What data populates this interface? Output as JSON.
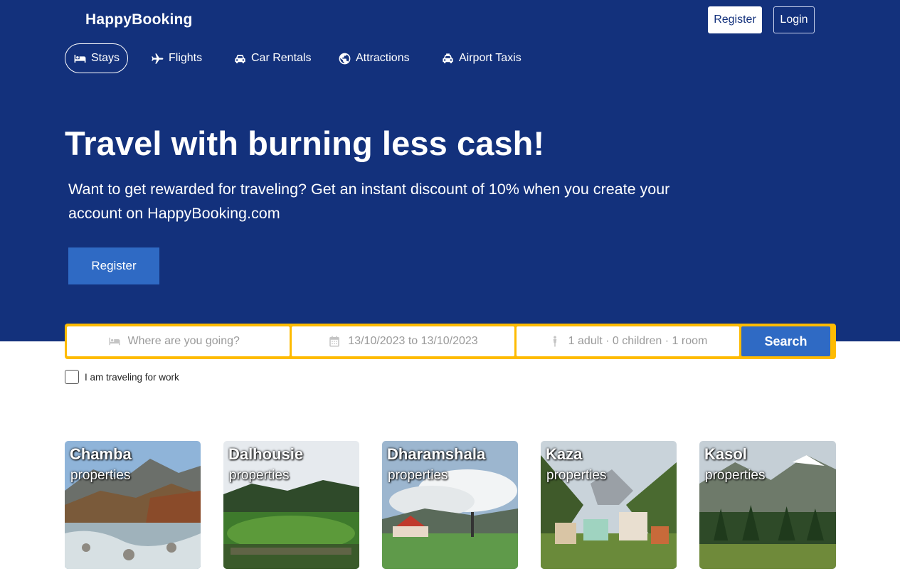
{
  "header": {
    "brand": "HappyBooking",
    "register_label": "Register",
    "login_label": "Login"
  },
  "nav": {
    "items": [
      {
        "label": "Stays",
        "icon": "bed-icon",
        "active": true
      },
      {
        "label": "Flights",
        "icon": "plane-icon",
        "active": false
      },
      {
        "label": "Car Rentals",
        "icon": "car-icon",
        "active": false
      },
      {
        "label": "Attractions",
        "icon": "globe-icon",
        "active": false
      },
      {
        "label": "Airport Taxis",
        "icon": "taxi-icon",
        "active": false
      }
    ]
  },
  "hero": {
    "title": "Travel with burning less cash!",
    "description": "Want to get rewarded for traveling? Get an instant discount of 10% when you create your account on HappyBooking.com",
    "cta_label": "Register"
  },
  "search": {
    "destination_placeholder": "Where are you going?",
    "dates": "13/10/2023 to 13/10/2023",
    "guests": "1 adult · 0 children · 1 room",
    "button_label": "Search"
  },
  "work_travel": {
    "label": "I am traveling for work",
    "checked": false
  },
  "destinations": [
    {
      "name": "Chamba",
      "sub": "properties"
    },
    {
      "name": "Dalhousie",
      "sub": "properties"
    },
    {
      "name": "Dharamshala",
      "sub": "properties"
    },
    {
      "name": "Kaza",
      "sub": "properties"
    },
    {
      "name": "Kasol",
      "sub": "properties"
    }
  ],
  "colors": {
    "hero_bg": "#13317c",
    "accent_blue": "#2f6ac4",
    "search_border": "#febb02"
  }
}
